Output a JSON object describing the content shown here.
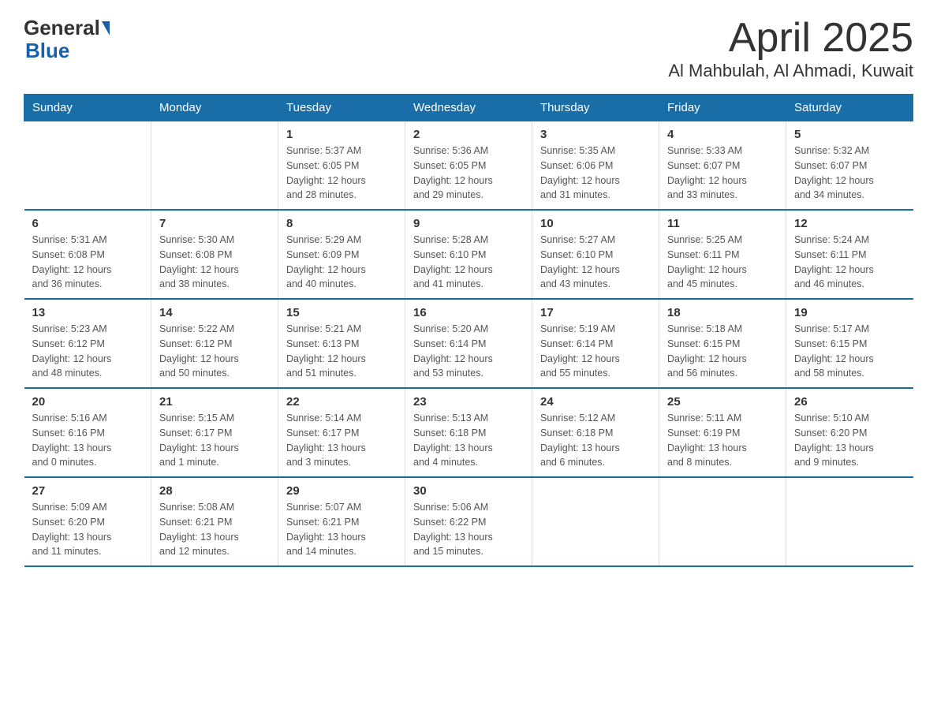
{
  "header": {
    "logo_general": "General",
    "logo_blue": "Blue",
    "month": "April 2025",
    "location": "Al Mahbulah, Al Ahmadi, Kuwait"
  },
  "weekdays": [
    "Sunday",
    "Monday",
    "Tuesday",
    "Wednesday",
    "Thursday",
    "Friday",
    "Saturday"
  ],
  "weeks": [
    [
      {
        "day": "",
        "info": ""
      },
      {
        "day": "",
        "info": ""
      },
      {
        "day": "1",
        "info": "Sunrise: 5:37 AM\nSunset: 6:05 PM\nDaylight: 12 hours\nand 28 minutes."
      },
      {
        "day": "2",
        "info": "Sunrise: 5:36 AM\nSunset: 6:05 PM\nDaylight: 12 hours\nand 29 minutes."
      },
      {
        "day": "3",
        "info": "Sunrise: 5:35 AM\nSunset: 6:06 PM\nDaylight: 12 hours\nand 31 minutes."
      },
      {
        "day": "4",
        "info": "Sunrise: 5:33 AM\nSunset: 6:07 PM\nDaylight: 12 hours\nand 33 minutes."
      },
      {
        "day": "5",
        "info": "Sunrise: 5:32 AM\nSunset: 6:07 PM\nDaylight: 12 hours\nand 34 minutes."
      }
    ],
    [
      {
        "day": "6",
        "info": "Sunrise: 5:31 AM\nSunset: 6:08 PM\nDaylight: 12 hours\nand 36 minutes."
      },
      {
        "day": "7",
        "info": "Sunrise: 5:30 AM\nSunset: 6:08 PM\nDaylight: 12 hours\nand 38 minutes."
      },
      {
        "day": "8",
        "info": "Sunrise: 5:29 AM\nSunset: 6:09 PM\nDaylight: 12 hours\nand 40 minutes."
      },
      {
        "day": "9",
        "info": "Sunrise: 5:28 AM\nSunset: 6:10 PM\nDaylight: 12 hours\nand 41 minutes."
      },
      {
        "day": "10",
        "info": "Sunrise: 5:27 AM\nSunset: 6:10 PM\nDaylight: 12 hours\nand 43 minutes."
      },
      {
        "day": "11",
        "info": "Sunrise: 5:25 AM\nSunset: 6:11 PM\nDaylight: 12 hours\nand 45 minutes."
      },
      {
        "day": "12",
        "info": "Sunrise: 5:24 AM\nSunset: 6:11 PM\nDaylight: 12 hours\nand 46 minutes."
      }
    ],
    [
      {
        "day": "13",
        "info": "Sunrise: 5:23 AM\nSunset: 6:12 PM\nDaylight: 12 hours\nand 48 minutes."
      },
      {
        "day": "14",
        "info": "Sunrise: 5:22 AM\nSunset: 6:12 PM\nDaylight: 12 hours\nand 50 minutes."
      },
      {
        "day": "15",
        "info": "Sunrise: 5:21 AM\nSunset: 6:13 PM\nDaylight: 12 hours\nand 51 minutes."
      },
      {
        "day": "16",
        "info": "Sunrise: 5:20 AM\nSunset: 6:14 PM\nDaylight: 12 hours\nand 53 minutes."
      },
      {
        "day": "17",
        "info": "Sunrise: 5:19 AM\nSunset: 6:14 PM\nDaylight: 12 hours\nand 55 minutes."
      },
      {
        "day": "18",
        "info": "Sunrise: 5:18 AM\nSunset: 6:15 PM\nDaylight: 12 hours\nand 56 minutes."
      },
      {
        "day": "19",
        "info": "Sunrise: 5:17 AM\nSunset: 6:15 PM\nDaylight: 12 hours\nand 58 minutes."
      }
    ],
    [
      {
        "day": "20",
        "info": "Sunrise: 5:16 AM\nSunset: 6:16 PM\nDaylight: 13 hours\nand 0 minutes."
      },
      {
        "day": "21",
        "info": "Sunrise: 5:15 AM\nSunset: 6:17 PM\nDaylight: 13 hours\nand 1 minute."
      },
      {
        "day": "22",
        "info": "Sunrise: 5:14 AM\nSunset: 6:17 PM\nDaylight: 13 hours\nand 3 minutes."
      },
      {
        "day": "23",
        "info": "Sunrise: 5:13 AM\nSunset: 6:18 PM\nDaylight: 13 hours\nand 4 minutes."
      },
      {
        "day": "24",
        "info": "Sunrise: 5:12 AM\nSunset: 6:18 PM\nDaylight: 13 hours\nand 6 minutes."
      },
      {
        "day": "25",
        "info": "Sunrise: 5:11 AM\nSunset: 6:19 PM\nDaylight: 13 hours\nand 8 minutes."
      },
      {
        "day": "26",
        "info": "Sunrise: 5:10 AM\nSunset: 6:20 PM\nDaylight: 13 hours\nand 9 minutes."
      }
    ],
    [
      {
        "day": "27",
        "info": "Sunrise: 5:09 AM\nSunset: 6:20 PM\nDaylight: 13 hours\nand 11 minutes."
      },
      {
        "day": "28",
        "info": "Sunrise: 5:08 AM\nSunset: 6:21 PM\nDaylight: 13 hours\nand 12 minutes."
      },
      {
        "day": "29",
        "info": "Sunrise: 5:07 AM\nSunset: 6:21 PM\nDaylight: 13 hours\nand 14 minutes."
      },
      {
        "day": "30",
        "info": "Sunrise: 5:06 AM\nSunset: 6:22 PM\nDaylight: 13 hours\nand 15 minutes."
      },
      {
        "day": "",
        "info": ""
      },
      {
        "day": "",
        "info": ""
      },
      {
        "day": "",
        "info": ""
      }
    ]
  ]
}
